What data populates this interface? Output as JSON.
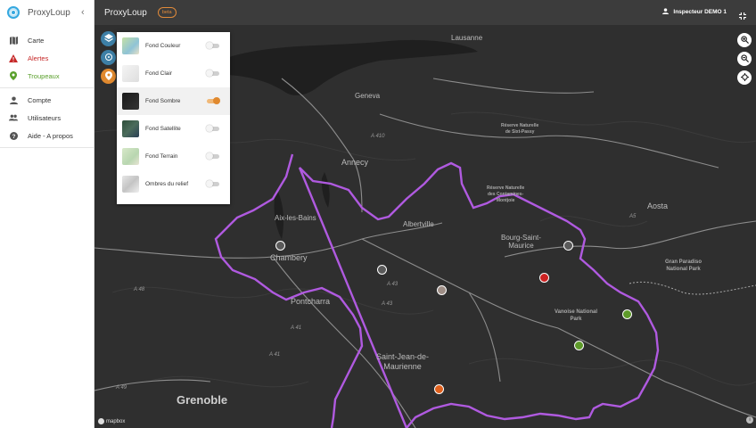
{
  "app": {
    "name": "ProxyLoup",
    "collapse_icon": "chevron-left-icon"
  },
  "sidebar": {
    "items": [
      {
        "label": "Carte",
        "icon": "map-icon"
      },
      {
        "label": "Alertes",
        "icon": "warning-icon"
      },
      {
        "label": "Troupeaux",
        "icon": "location-pin-icon"
      },
      {
        "label": "Compte",
        "icon": "person-icon"
      },
      {
        "label": "Utilisateurs",
        "icon": "people-icon"
      },
      {
        "label": "Aide - A propos",
        "icon": "help-icon"
      }
    ]
  },
  "topbar": {
    "title": "ProxyLoup",
    "badge": "beta",
    "user": "Inspecteur DEMO 1"
  },
  "layers": {
    "items": [
      {
        "label": "Fond Couleur",
        "enabled": false
      },
      {
        "label": "Fond Clair",
        "enabled": false
      },
      {
        "label": "Fond Sombre",
        "enabled": true
      },
      {
        "label": "Fond Satellite",
        "enabled": false
      },
      {
        "label": "Fond Terrain",
        "enabled": false
      },
      {
        "label": "Ombres du relief",
        "enabled": false
      }
    ]
  },
  "map": {
    "labels": {
      "lausanne": "Lausanne",
      "geneva": "Geneva",
      "annecy": "Annecy",
      "aix": "Aix-les-Bains",
      "chambery": "Chambery",
      "albertville": "Albertville",
      "bourg": "Bourg-Saint-\nMaurice",
      "aosta": "Aosta",
      "pontcharra": "Pontcharra",
      "saint_jean": "Saint-Jean-de-\nMaurienne",
      "grenoble": "Grenoble",
      "vanoise": "Vanoise National\nPark",
      "gran_paradiso": "Gran Paradiso\nNational Park",
      "reserve_contamines": "Réserve Naturelle\ndes Contamines-\nMontjoie",
      "reserve_sixt": "Réserve Naturelle\nde Sixt-Passy",
      "a410": "A 410",
      "a43a": "A 43",
      "a43b": "A 43",
      "a48": "A 48",
      "a41a": "A 41",
      "a41b": "A 41",
      "a49": "A 49",
      "a5": "A5"
    },
    "attribution": "mapbox",
    "colors": {
      "boundary": "#b05ae0",
      "marker_white": "#5a5a5a",
      "marker_red": "#cc2222",
      "marker_green": "#5e9a2a",
      "marker_orange": "#e0601c",
      "marker_grey": "#9e8e86"
    }
  },
  "icons": {
    "zoom_in": "zoom-in-icon",
    "zoom_out": "zoom-out-icon",
    "locate": "locate-icon",
    "layers": "layers-icon",
    "fullscreen": "fullscreen-icon",
    "info": "info-icon"
  }
}
